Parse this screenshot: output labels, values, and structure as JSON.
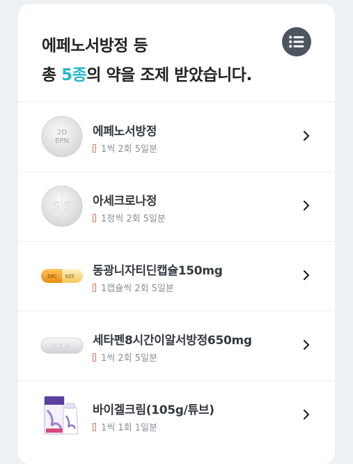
{
  "header": {
    "title_line1": "에페노서방정 등",
    "title_prefix": "총 ",
    "title_count": "5종",
    "title_suffix": "의 약을 조제 받았습니다.",
    "list_icon": "list-icon"
  },
  "medications": [
    {
      "name": "에페노서방정",
      "dose": "1씩 2회 5일분",
      "imprint": "2D EPN",
      "image_icon": "white-round-tablet"
    },
    {
      "name": "아세크로나정",
      "dose": "1정씩 2회 5일분",
      "imprint": "S S",
      "image_icon": "white-round-tablet"
    },
    {
      "name": "동광니자티딘캡슐150mg",
      "dose": "1캡슐씩 2회 5일분",
      "imprint": "DPC NZT",
      "image_icon": "orange-capsule"
    },
    {
      "name": "세타펜8시간이알서방정650mg",
      "dose": "1씩 2회 5일분",
      "imprint": "CEN",
      "image_icon": "white-oblong-tablet"
    },
    {
      "name": "바이겔크림(105g/튜브)",
      "dose": "1씩 1회 1일분",
      "image_icon": "cream-tube-box"
    }
  ],
  "colors": {
    "accent": "#22b8c8",
    "dose_mark": "#d9735a",
    "list_button": "#4d5560"
  }
}
